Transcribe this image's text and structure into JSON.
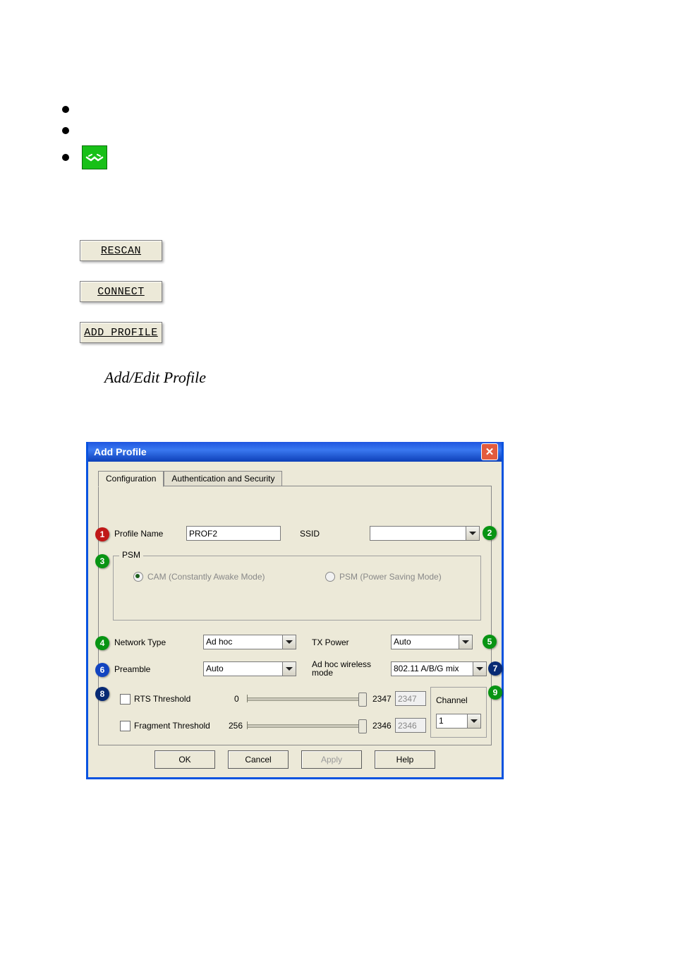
{
  "top_buttons": {
    "rescan": "RESCAN",
    "connect": "CONNECT",
    "add_profile": "ADD PROFILE"
  },
  "section_title": "Add/Edit Profile",
  "dialog": {
    "title": "Add Profile",
    "tabs": {
      "config": "Configuration",
      "auth": "Authentication and Security"
    },
    "profile_name_label": "Profile Name",
    "profile_name_value": "PROF2",
    "ssid_label": "SSID",
    "ssid_value": "",
    "psm": {
      "legend": "PSM",
      "cam": "CAM (Constantly Awake Mode)",
      "psm": "PSM (Power Saving Mode)"
    },
    "network_type_label": "Network Type",
    "network_type_value": "Ad hoc",
    "tx_power_label": "TX Power",
    "tx_power_value": "Auto",
    "preamble_label": "Preamble",
    "preamble_value": "Auto",
    "adhoc_mode_label": "Ad hoc wireless mode",
    "adhoc_mode_value": "802.11 A/B/G mix",
    "rts_label": "RTS Threshold",
    "rts_min": "0",
    "rts_max": "2347",
    "rts_value": "2347",
    "frag_label": "Fragment Threshold",
    "frag_min": "256",
    "frag_max": "2346",
    "frag_value": "2346",
    "channel_label": "Channel",
    "channel_value": "1",
    "buttons": {
      "ok": "OK",
      "cancel": "Cancel",
      "apply": "Apply",
      "help": "Help"
    }
  },
  "badges": {
    "b1": "1",
    "b2": "2",
    "b3": "3",
    "b4": "4",
    "b5": "5",
    "b6": "6",
    "b7": "7",
    "b8": "8",
    "b9": "9"
  }
}
